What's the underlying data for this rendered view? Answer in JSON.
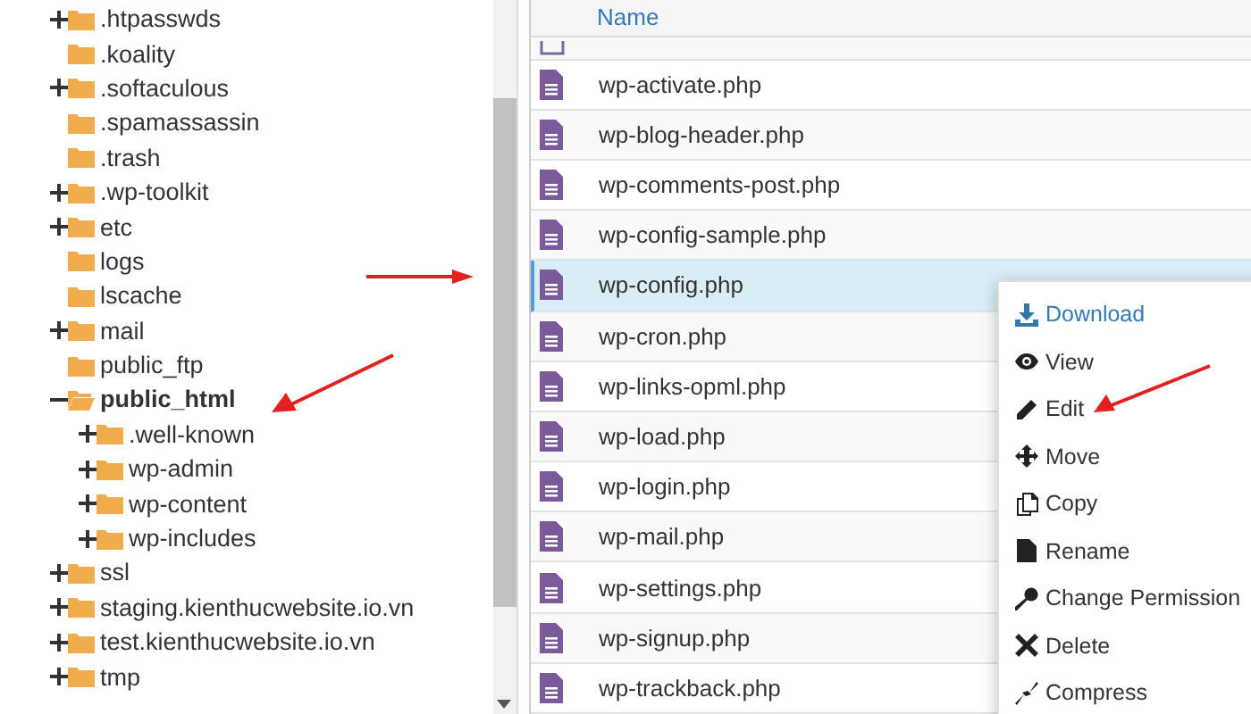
{
  "tree": [
    {
      "name": ".htpasswds",
      "expanded": false,
      "selected": false
    },
    {
      "name": ".koality",
      "selected": false
    },
    {
      "name": ".softaculous",
      "expanded": false,
      "selected": false
    },
    {
      "name": ".spamassassin",
      "selected": false
    },
    {
      "name": ".trash",
      "selected": false
    },
    {
      "name": ".wp-toolkit",
      "expanded": false,
      "selected": false
    },
    {
      "name": "etc",
      "expanded": false,
      "selected": false
    },
    {
      "name": "logs",
      "selected": false
    },
    {
      "name": "lscache",
      "selected": false
    },
    {
      "name": "mail",
      "expanded": false,
      "selected": false
    },
    {
      "name": "public_ftp",
      "selected": false
    },
    {
      "name": "public_html",
      "expanded": true,
      "selected": true,
      "children": [
        {
          "name": ".well-known",
          "expanded": false,
          "selected": false
        },
        {
          "name": "wp-admin",
          "expanded": false,
          "selected": false
        },
        {
          "name": "wp-content",
          "expanded": false,
          "selected": false
        },
        {
          "name": "wp-includes",
          "expanded": false,
          "selected": false
        }
      ]
    },
    {
      "name": "ssl",
      "expanded": false,
      "selected": false
    },
    {
      "name": "staging.kienthucwebsite.io.vn",
      "expanded": false,
      "selected": false
    },
    {
      "name": "test.kienthucwebsite.io.vn",
      "expanded": false,
      "selected": false
    },
    {
      "name": "tmp",
      "expanded": false,
      "selected": false
    }
  ],
  "table": {
    "columns": [
      "Name"
    ],
    "files": [
      {
        "name": "wp-activate.php",
        "selected": false
      },
      {
        "name": "wp-blog-header.php",
        "selected": false
      },
      {
        "name": "wp-comments-post.php",
        "selected": false
      },
      {
        "name": "wp-config-sample.php",
        "selected": false
      },
      {
        "name": "wp-config.php",
        "selected": true
      },
      {
        "name": "wp-cron.php",
        "selected": false
      },
      {
        "name": "wp-links-opml.php",
        "selected": false
      },
      {
        "name": "wp-load.php",
        "selected": false
      },
      {
        "name": "wp-login.php",
        "selected": false
      },
      {
        "name": "wp-mail.php",
        "selected": false
      },
      {
        "name": "wp-settings.php",
        "selected": false
      },
      {
        "name": "wp-signup.php",
        "selected": false
      },
      {
        "name": "wp-trackback.php",
        "selected": false
      }
    ]
  },
  "context_menu": [
    {
      "label": "Download",
      "highlighted": true
    },
    {
      "label": "View",
      "highlighted": false
    },
    {
      "label": "Edit",
      "highlighted": false
    },
    {
      "label": "Move",
      "highlighted": false
    },
    {
      "label": "Copy",
      "highlighted": false
    },
    {
      "label": "Rename",
      "highlighted": false
    },
    {
      "label": "Change Permission",
      "highlighted": false
    },
    {
      "label": "Delete",
      "highlighted": false
    },
    {
      "label": "Compress",
      "highlighted": false
    }
  ]
}
